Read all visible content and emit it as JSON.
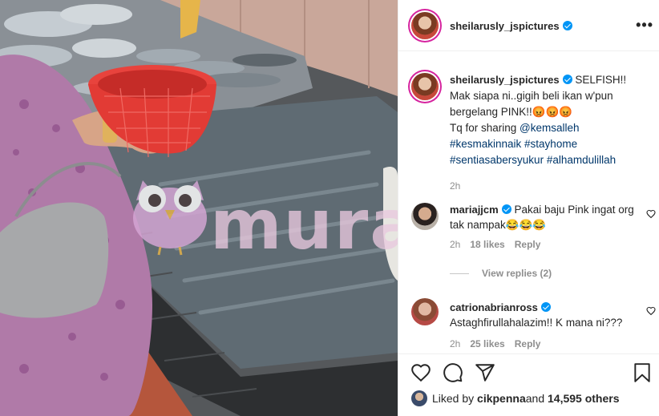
{
  "post": {
    "author": "sheilarusly_jspictures",
    "watermark": "murai",
    "more_icon": "more-options-icon"
  },
  "caption": {
    "username": "sheilarusly_jspictures",
    "text_1": " SELFISH!!",
    "text_2": "Mak siapa ni..gigih beli ikan w'pun bergelang PINK!!😡😡😡",
    "text_3": "Tq for sharing ",
    "mention": "@kemsalleh",
    "hashtags_line1": "#kesmakinnaik #stayhome",
    "hashtags_line2": "#sentiasabersyukur #alhamdulillah",
    "time": "2h"
  },
  "comments": [
    {
      "username": "mariajjcm",
      "text": "Pakai baju Pink ingat org tak nampak😂😂😂",
      "time": "2h",
      "likes": "18 likes",
      "reply": "Reply"
    },
    {
      "username": "catrionabrianross",
      "text": "Astaghfirullahalazim!! K mana ni???",
      "time": "2h",
      "likes": "25 likes",
      "reply": "Reply"
    }
  ],
  "view_replies": "View replies (2)",
  "likes_bar": {
    "prefix": "Liked by ",
    "user": "cikpenna",
    "mid": " and ",
    "count": "14,595 others"
  },
  "colors": {
    "accent_blue": "#0095f6",
    "link": "#00376b",
    "secondary_text": "#8e8e8e",
    "story_ring": "#d6249f"
  }
}
